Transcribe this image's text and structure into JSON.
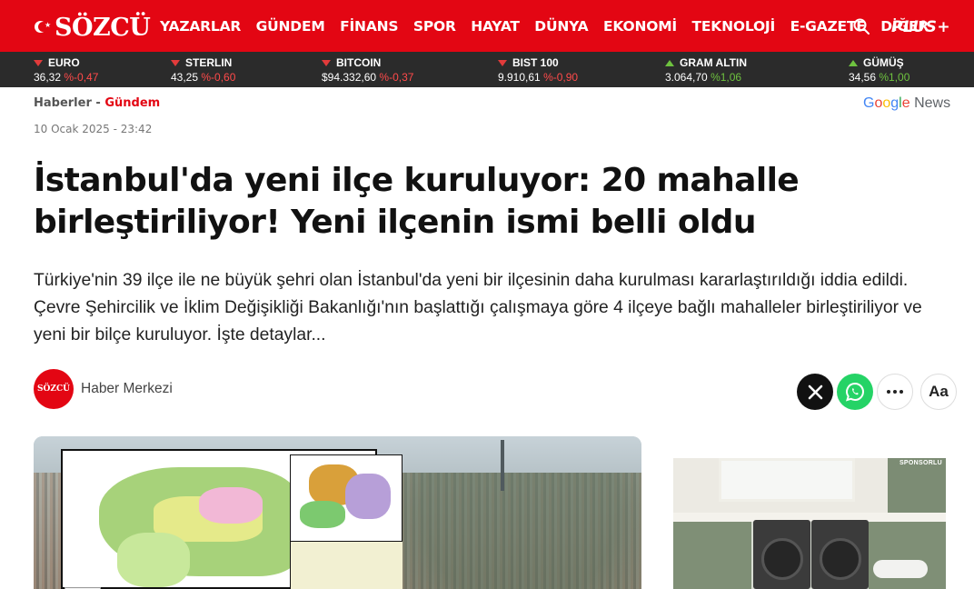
{
  "header": {
    "logo_text": "SÖZCÜ",
    "nav": [
      "YAZARLAR",
      "GÜNDEM",
      "FİNANS",
      "SPOR",
      "HAYAT",
      "DÜNYA",
      "EKONOMİ",
      "TEKNOLOJİ",
      "E-GAZETE",
      "DİĞER"
    ],
    "plus_label": "PLUS+",
    "icons": {
      "search": "search-icon"
    }
  },
  "ticker": [
    {
      "name": "EURO",
      "value": "36,32",
      "change": "%-0,47",
      "direction": "down"
    },
    {
      "name": "STERLIN",
      "value": "43,25",
      "change": "%-0,60",
      "direction": "down"
    },
    {
      "name": "BITCOIN",
      "value": "$94.332,60",
      "change": "%-0,37",
      "direction": "down"
    },
    {
      "name": "BIST 100",
      "value": "9.910,61",
      "change": "%-0,90",
      "direction": "down"
    },
    {
      "name": "GRAM ALTIN",
      "value": "3.064,70",
      "change": "%1,06",
      "direction": "up"
    },
    {
      "name": "GÜMÜŞ",
      "value": "34,56",
      "change": "%1,00",
      "direction": "up"
    }
  ],
  "breadcrumb": {
    "home": "Haberler",
    "separator": " - ",
    "current": "Gündem"
  },
  "google_news": {
    "g": "G",
    "o1": "o",
    "o2": "o",
    "g2": "g",
    "l": "l",
    "e": "e",
    "news": " News"
  },
  "date": "10 Ocak 2025 - 23:42",
  "article": {
    "title": "İstanbul'da yeni ilçe kuruluyor: 20 mahalle birleştiriliyor! Yeni ilçenin ismi belli oldu",
    "spot": "Türkiye'nin 39 ilçe ile ne büyük şehri olan İstanbul'da yeni bir ilçesinin daha kurulması kararlaştırıldığı iddia edildi. Çevre Şehircilik ve İklim Değişikliği Bakanlığı'nın başlattığı çalışmaya göre 4 ilçeye bağlı mahalleler birleştiriliyor ve yeni bir bilçe kuruluyor. İşte detaylar..."
  },
  "author": {
    "avatar_text": "SÖZCÜ",
    "name": "Haber Merkezi"
  },
  "share": {
    "font_label": "Aa"
  },
  "ad": {
    "label": "SPONSORLU"
  },
  "colors": {
    "brand": "#e30613",
    "ticker_bg": "#2b2b2b",
    "down": "#ff4a4a",
    "up": "#6ec23f"
  }
}
